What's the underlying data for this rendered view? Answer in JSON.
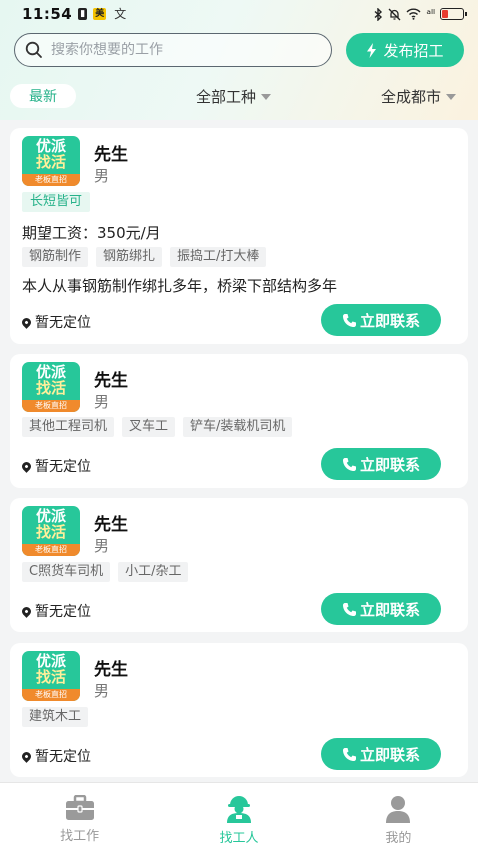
{
  "status_bar": {
    "time": "11:54",
    "mini_a": "▮",
    "mini_b": "美",
    "mini_c": "文",
    "signal": "ᵃˡˡ"
  },
  "search": {
    "placeholder": "搜索你想要的工作"
  },
  "post_button": {
    "label": "发布招工",
    "icon": "lightning-icon"
  },
  "filters": {
    "latest": "最新",
    "job_type": "全部工种",
    "city": "全成都市"
  },
  "logo": {
    "line1": "优派",
    "line2": "找活",
    "line3": "老板直招"
  },
  "cards": [
    {
      "name": "先生",
      "gender": "男",
      "badge": "长短皆可",
      "wage": "期望工资：350元/月",
      "tags": [
        "钢筋制作",
        "钢筋绑扎",
        "振捣工/打大棒"
      ],
      "description": "本人从事钢筋制作绑扎多年，桥梁下部结构多年",
      "location": "暂无定位",
      "contact": "立即联系"
    },
    {
      "name": "先生",
      "gender": "男",
      "tags": [
        "其他工程司机",
        "叉车工",
        "铲车/装载机司机"
      ],
      "location": "暂无定位",
      "contact": "立即联系"
    },
    {
      "name": "先生",
      "gender": "男",
      "tags": [
        "C照货车司机",
        "小工/杂工"
      ],
      "location": "暂无定位",
      "contact": "立即联系"
    },
    {
      "name": "先生",
      "gender": "男",
      "tags": [
        "建筑木工"
      ],
      "location": "暂无定位",
      "contact": "立即联系"
    }
  ],
  "bottom_nav": [
    {
      "label": "找工作",
      "icon": "briefcase-icon",
      "active": false
    },
    {
      "label": "找工人",
      "icon": "worker-icon",
      "active": true
    },
    {
      "label": "我的",
      "icon": "person-icon",
      "active": false
    }
  ],
  "colors": {
    "accent": "#27c79a",
    "accent_text": "#27b28a",
    "logo_band": "#f08a2c"
  }
}
